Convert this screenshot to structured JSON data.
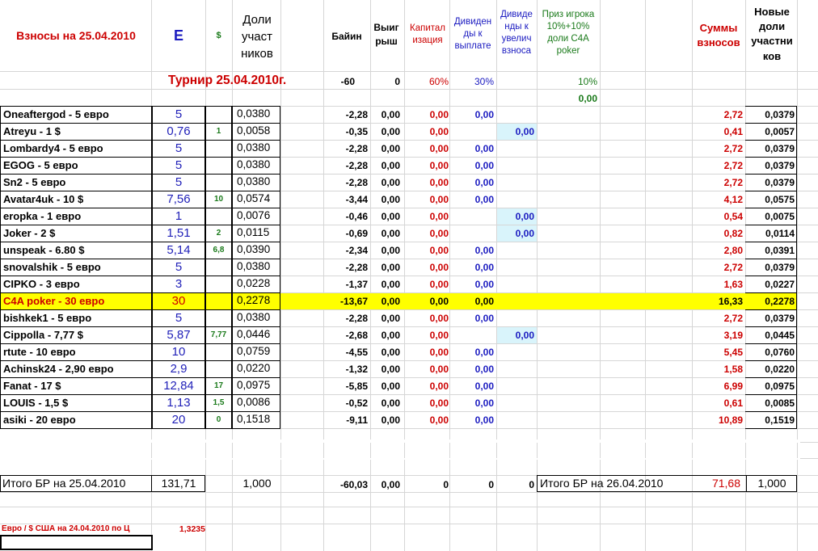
{
  "header": {
    "title": "Взносы на 25.04.2010",
    "col_e": "Е",
    "col_dollar": "$",
    "col_doli": "Доли участ ников",
    "col_bayin": "Байин",
    "col_vyigr": "Выиг рыш",
    "col_kapital": "Капитал изация",
    "col_divid": "Дивиден ды к выплате",
    "col_divid_uv": "Дивиде нды к увелич взноса",
    "col_priz": "Приз игрока 10%+10% доли С4А poker",
    "col_summy": "Суммы взносов",
    "col_novye": "Новые доли участни ков"
  },
  "tournament": {
    "title": "Турнир 25.04.2010г.",
    "bayin": "-60",
    "vyigr": "0",
    "kapital": "60%",
    "divid": "30%",
    "priz": "10%",
    "priz_value": "0,00"
  },
  "rows": [
    {
      "name": "Oneaftergod - 5 евро",
      "e": "5",
      "usd": "",
      "dolya": "0,0380",
      "bayin": "-2,28",
      "vyigr": "0,00",
      "kap": "0,00",
      "div": "0,00",
      "div_uv": "",
      "sum": "2,72",
      "nov": "0,0379"
    },
    {
      "name": "Atreyu - 1 $",
      "e": "0,76",
      "usd": "1",
      "dolya": "0,0058",
      "bayin": "-0,35",
      "vyigr": "0,00",
      "kap": "0,00",
      "div": "",
      "div_uv": "0,00",
      "sum": "0,41",
      "nov": "0,0057"
    },
    {
      "name": "Lombardy4 - 5 евро",
      "e": "5",
      "usd": "",
      "dolya": "0,0380",
      "bayin": "-2,28",
      "vyigr": "0,00",
      "kap": "0,00",
      "div": "0,00",
      "div_uv": "",
      "sum": "2,72",
      "nov": "0,0379"
    },
    {
      "name": "EGOG - 5 евро",
      "e": "5",
      "usd": "",
      "dolya": "0,0380",
      "bayin": "-2,28",
      "vyigr": "0,00",
      "kap": "0,00",
      "div": "0,00",
      "div_uv": "",
      "sum": "2,72",
      "nov": "0,0379"
    },
    {
      "name": "Sn2 - 5 евро",
      "e": "5",
      "usd": "",
      "dolya": "0,0380",
      "bayin": "-2,28",
      "vyigr": "0,00",
      "kap": "0,00",
      "div": "0,00",
      "div_uv": "",
      "sum": "2,72",
      "nov": "0,0379"
    },
    {
      "name": "Avatar4uk - 10 $",
      "e": "7,56",
      "usd": "10",
      "dolya": "0,0574",
      "bayin": "-3,44",
      "vyigr": "0,00",
      "kap": "0,00",
      "div": "0,00",
      "div_uv": "",
      "sum": "4,12",
      "nov": "0,0575"
    },
    {
      "name": "eropka - 1 евро",
      "e": "1",
      "usd": "",
      "dolya": "0,0076",
      "bayin": "-0,46",
      "vyigr": "0,00",
      "kap": "0,00",
      "div": "",
      "div_uv": "0,00",
      "sum": "0,54",
      "nov": "0,0075"
    },
    {
      "name": "Joker - 2 $",
      "e": "1,51",
      "usd": "2",
      "dolya": "0,0115",
      "bayin": "-0,69",
      "vyigr": "0,00",
      "kap": "0,00",
      "div": "",
      "div_uv": "0,00",
      "sum": "0,82",
      "nov": "0,0114"
    },
    {
      "name": "unspeak - 6.80 $",
      "e": "5,14",
      "usd": "6,8",
      "dolya": "0,0390",
      "bayin": "-2,34",
      "vyigr": "0,00",
      "kap": "0,00",
      "div": "0,00",
      "div_uv": "",
      "sum": "2,80",
      "nov": "0,0391"
    },
    {
      "name": "snovalshik - 5 евро",
      "e": "5",
      "usd": "",
      "dolya": "0,0380",
      "bayin": "-2,28",
      "vyigr": "0,00",
      "kap": "0,00",
      "div": "0,00",
      "div_uv": "",
      "sum": "2,72",
      "nov": "0,0379"
    },
    {
      "name": "CIPKO - 3 евро",
      "e": "3",
      "usd": "",
      "dolya": "0,0228",
      "bayin": "-1,37",
      "vyigr": "0,00",
      "kap": "0,00",
      "div": "0,00",
      "div_uv": "",
      "sum": "1,63",
      "nov": "0,0227"
    },
    {
      "name": "C4A poker - 30 евро",
      "e": "30",
      "usd": "",
      "dolya": "0,2278",
      "bayin": "-13,67",
      "vyigr": "0,00",
      "kap": "0,00",
      "div": "0,00",
      "div_uv": "",
      "sum": "16,33",
      "nov": "0,2278",
      "highlight": true
    },
    {
      "name": "bishkek1 - 5 евро",
      "e": "5",
      "usd": "",
      "dolya": "0,0380",
      "bayin": "-2,28",
      "vyigr": "0,00",
      "kap": "0,00",
      "div": "0,00",
      "div_uv": "",
      "sum": "2,72",
      "nov": "0,0379"
    },
    {
      "name": "Cippolla - 7,77 $",
      "e": "5,87",
      "usd": "7,77",
      "dolya": "0,0446",
      "bayin": "-2,68",
      "vyigr": "0,00",
      "kap": "0,00",
      "div": "",
      "div_uv": "0,00",
      "sum": "3,19",
      "nov": "0,0445"
    },
    {
      "name": "rtute - 10 евро",
      "e": "10",
      "usd": "",
      "dolya": "0,0759",
      "bayin": "-4,55",
      "vyigr": "0,00",
      "kap": "0,00",
      "div": "0,00",
      "div_uv": "",
      "sum": "5,45",
      "nov": "0,0760"
    },
    {
      "name": "Achinsk24 - 2,90 евро",
      "e": "2,9",
      "usd": "",
      "dolya": "0,0220",
      "bayin": "-1,32",
      "vyigr": "0,00",
      "kap": "0,00",
      "div": "0,00",
      "div_uv": "",
      "sum": "1,58",
      "nov": "0,0220"
    },
    {
      "name": "Fanat - 17 $",
      "e": "12,84",
      "usd": "17",
      "dolya": "0,0975",
      "bayin": "-5,85",
      "vyigr": "0,00",
      "kap": "0,00",
      "div": "0,00",
      "div_uv": "",
      "sum": "6,99",
      "nov": "0,0975"
    },
    {
      "name": "LOUIS - 1,5 $",
      "e": "1,13",
      "usd": "1,5",
      "dolya": "0,0086",
      "bayin": "-0,52",
      "vyigr": "0,00",
      "kap": "0,00",
      "div": "0,00",
      "div_uv": "",
      "sum": "0,61",
      "nov": "0,0085"
    },
    {
      "name": "asiki - 20 евро",
      "e": "20",
      "usd": "0",
      "dolya": "0,1518",
      "bayin": "-9,11",
      "vyigr": "0,00",
      "kap": "0,00",
      "div": "0,00",
      "div_uv": "",
      "sum": "10,89",
      "nov": "0,1519"
    }
  ],
  "totals": {
    "label": "Итого БР на 25.04.2010",
    "e": "131,71",
    "dolya": "1,000",
    "bayin": "-60,03",
    "vyigr": "0,00",
    "kap": "0",
    "div": "0",
    "div_uv": "0",
    "label2": "Итого БР на 26.04.2010",
    "sum": "71,68",
    "nov": "1,000"
  },
  "rate": {
    "label": "Евро / $ США на 24.04.2010 по Ц",
    "value": "1,3235"
  },
  "colors": {
    "highlight": "#ffff00",
    "cyan_cell": "#d9f4fb",
    "red": "#cc0000",
    "blue": "#1a1ac0",
    "green": "#1a7a1a"
  }
}
